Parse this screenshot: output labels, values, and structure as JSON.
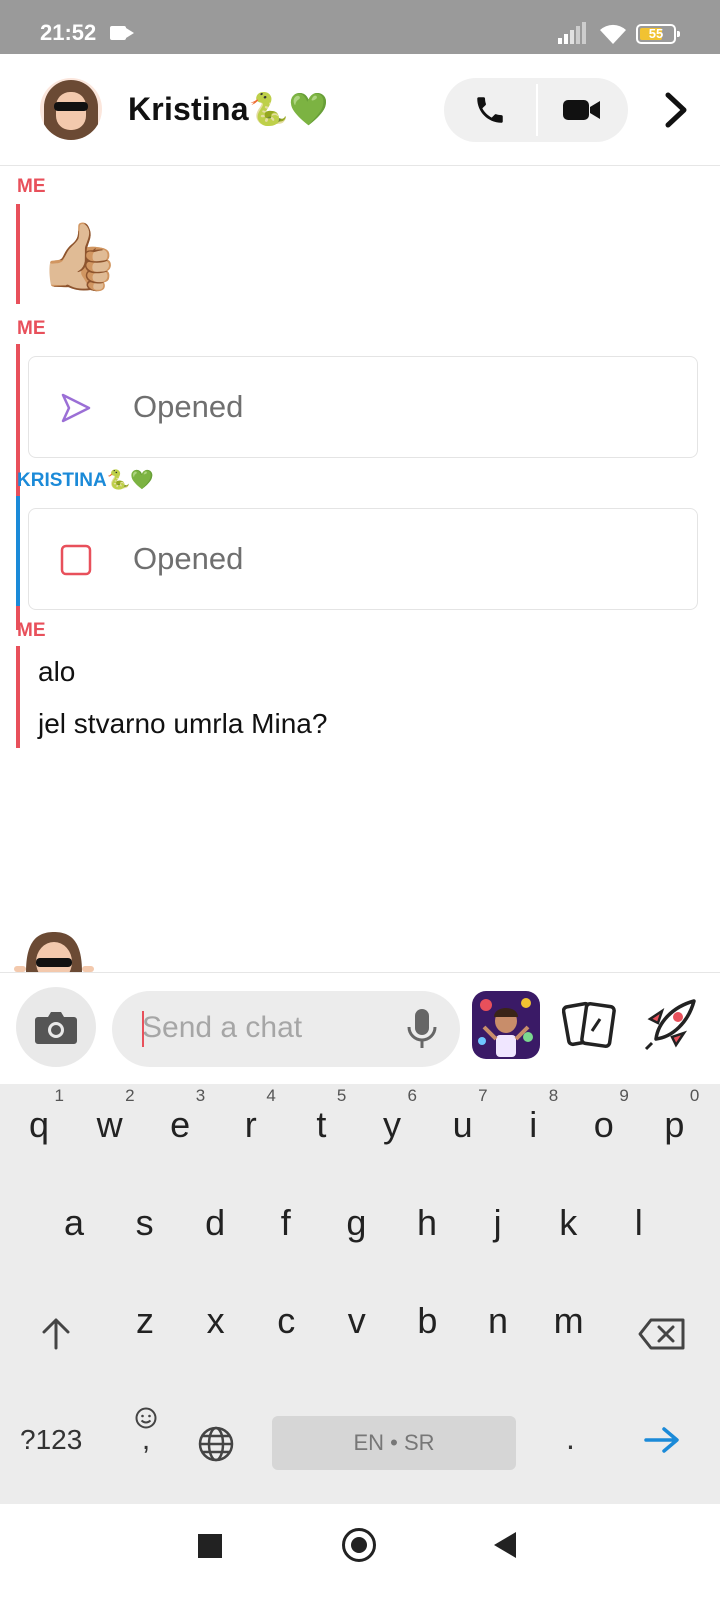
{
  "status_bar": {
    "time": "21:52",
    "battery_level": "55"
  },
  "header": {
    "contact_name": "Kristina🐍💚"
  },
  "chat": {
    "messages": [
      {
        "sender": "ME",
        "type": "emoji",
        "content": "👍🏼"
      },
      {
        "sender": "ME",
        "type": "snap",
        "status": "Opened"
      },
      {
        "sender": "KRISTINA🐍💚",
        "type": "chat",
        "status": "Opened"
      },
      {
        "sender": "ME",
        "type": "text",
        "lines": [
          "alo",
          "jel stvarno umrla Mina?"
        ]
      }
    ]
  },
  "input": {
    "placeholder": "Send a chat",
    "value": ""
  },
  "keyboard": {
    "row1": [
      {
        "letter": "q",
        "num": "1"
      },
      {
        "letter": "w",
        "num": "2"
      },
      {
        "letter": "e",
        "num": "3"
      },
      {
        "letter": "r",
        "num": "4"
      },
      {
        "letter": "t",
        "num": "5"
      },
      {
        "letter": "y",
        "num": "6"
      },
      {
        "letter": "u",
        "num": "7"
      },
      {
        "letter": "i",
        "num": "8"
      },
      {
        "letter": "o",
        "num": "9"
      },
      {
        "letter": "p",
        "num": "0"
      }
    ],
    "row2": [
      "a",
      "s",
      "d",
      "f",
      "g",
      "h",
      "j",
      "k",
      "l"
    ],
    "row3": [
      "z",
      "x",
      "c",
      "v",
      "b",
      "n",
      "m"
    ],
    "symbols_label": "?123",
    "comma": ",",
    "space_label": "EN • SR",
    "period": "."
  },
  "colors": {
    "me": "#e8505b",
    "friend": "#1b8ad8",
    "snap_opened": "#9b6fd6",
    "chat_opened": "#e8505b",
    "enter": "#1b8ad8"
  }
}
